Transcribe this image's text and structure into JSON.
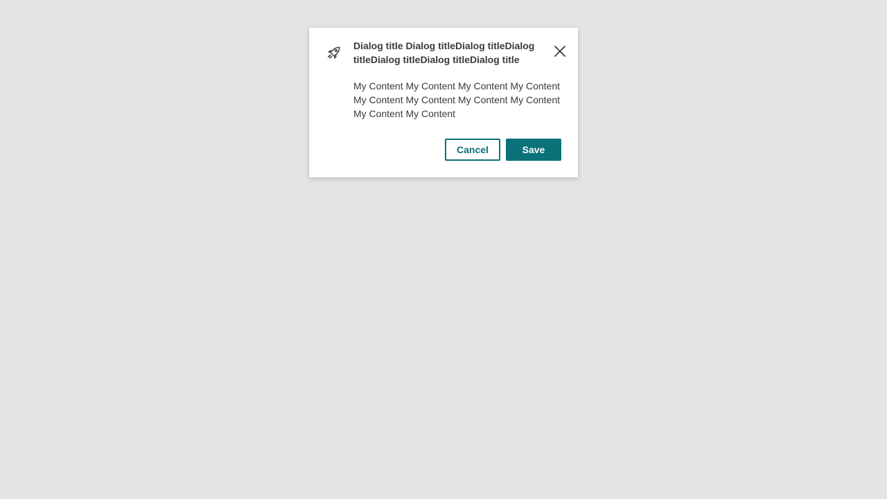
{
  "dialog": {
    "icon": "rocket-icon",
    "title": "Dialog title Dialog titleDialog titleDialog titleDialog titleDialog titleDialog title",
    "close_icon": "close-icon",
    "content": "My Content My Content My Content My Content My Content My Content My Content My Content My Content My Content",
    "cancel_label": "Cancel",
    "save_label": "Save"
  },
  "colors": {
    "background": "#e4e4e4",
    "dialog_background": "#ffffff",
    "accent": "#0b7279",
    "text": "#3a3a3a"
  }
}
